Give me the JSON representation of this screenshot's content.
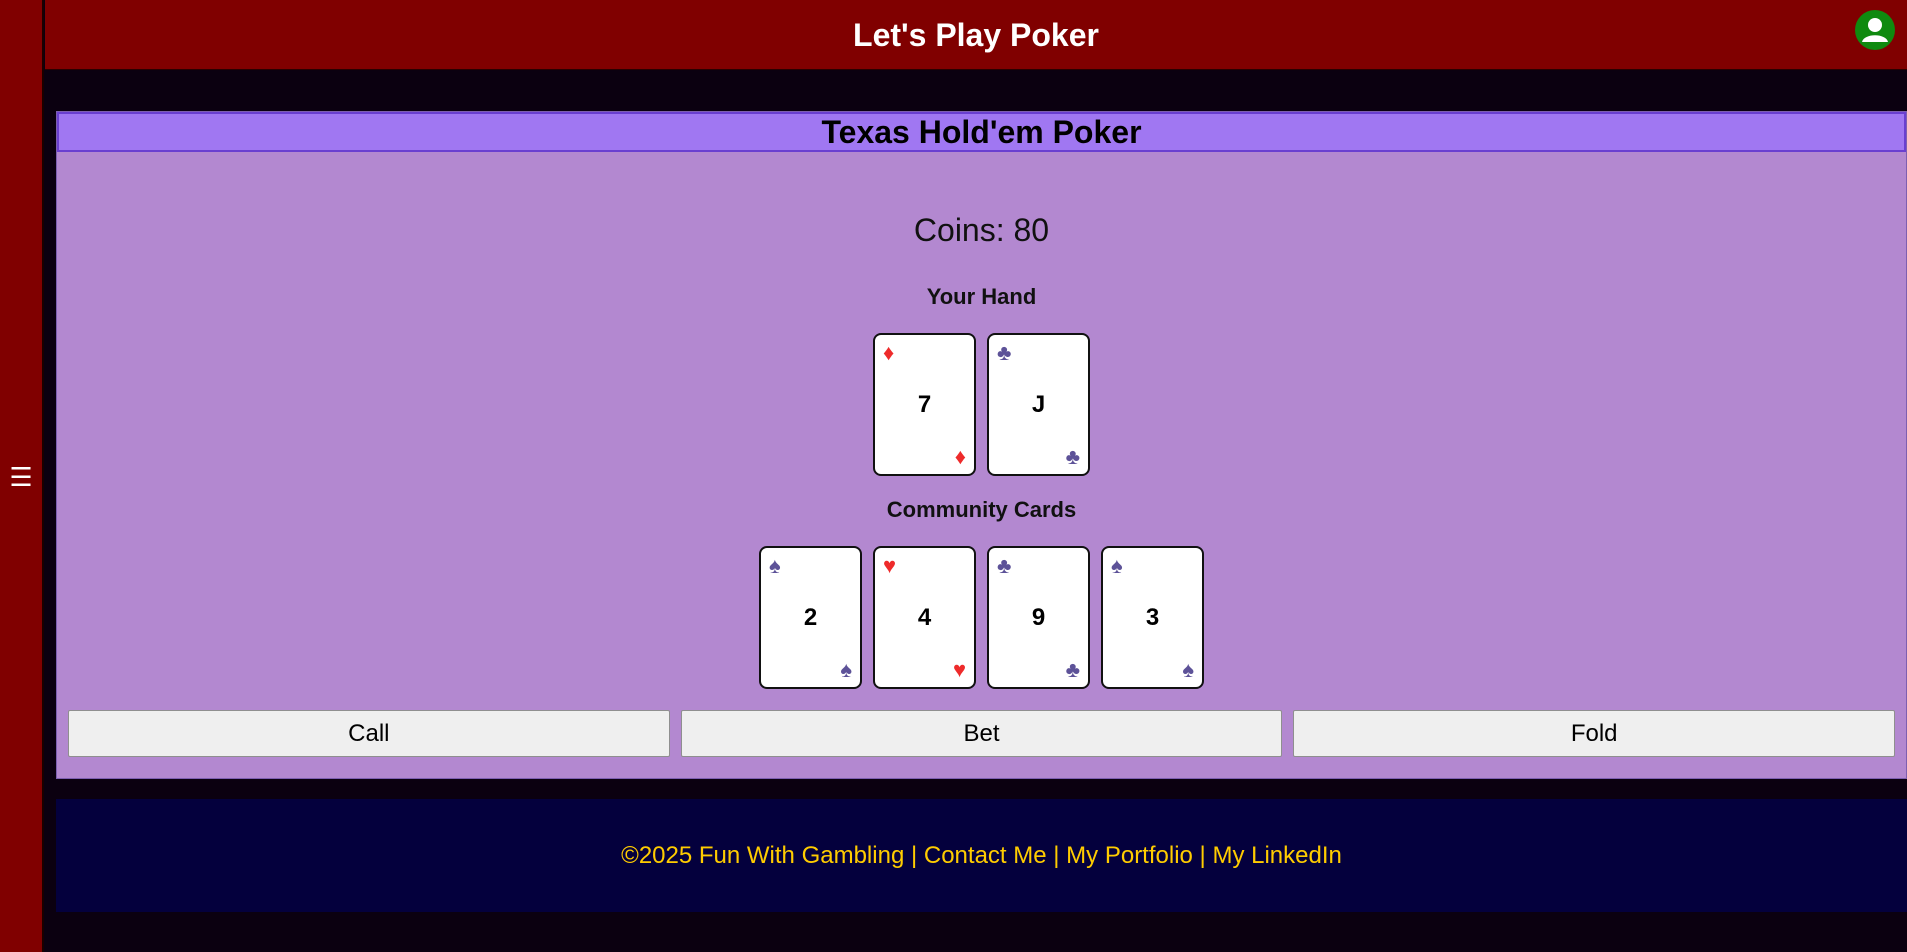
{
  "sidebar": {
    "menu_glyph": "☰"
  },
  "header": {
    "title": "Let's Play Poker",
    "avatar_icon": "user-icon",
    "avatar_color": "#0f8a0f"
  },
  "game": {
    "title": "Texas Hold'em Poker",
    "coins_text": "Coins: 80",
    "hand_label": "Your Hand",
    "community_label": "Community Cards",
    "hand_cards": [
      {
        "rank": "7",
        "suit": "diamonds",
        "suit_glyph": "♦",
        "color": "red"
      },
      {
        "rank": "J",
        "suit": "clubs",
        "suit_glyph": "♣",
        "color": "dark"
      }
    ],
    "community_cards": [
      {
        "rank": "2",
        "suit": "spades",
        "suit_glyph": "♠",
        "color": "dark"
      },
      {
        "rank": "4",
        "suit": "hearts",
        "suit_glyph": "♥",
        "color": "red"
      },
      {
        "rank": "9",
        "suit": "clubs",
        "suit_glyph": "♣",
        "color": "dark"
      },
      {
        "rank": "3",
        "suit": "spades",
        "suit_glyph": "♠",
        "color": "dark"
      }
    ],
    "actions": {
      "call": "Call",
      "bet": "Bet",
      "fold": "Fold"
    }
  },
  "footer": {
    "copyright": "©2025 Fun With Gambling",
    "separator": " | ",
    "contact": "Contact Me",
    "portfolio": "My Portfolio",
    "linkedin": "My LinkedIn"
  },
  "colors": {
    "header_bg": "#800000",
    "panel_bg": "#b388d0",
    "title_bar_bg": "#a077f2",
    "footer_bg": "#04003d",
    "footer_text": "#ffcc00",
    "suit_red": "#ee2b2b",
    "suit_dark": "#5d5298"
  }
}
